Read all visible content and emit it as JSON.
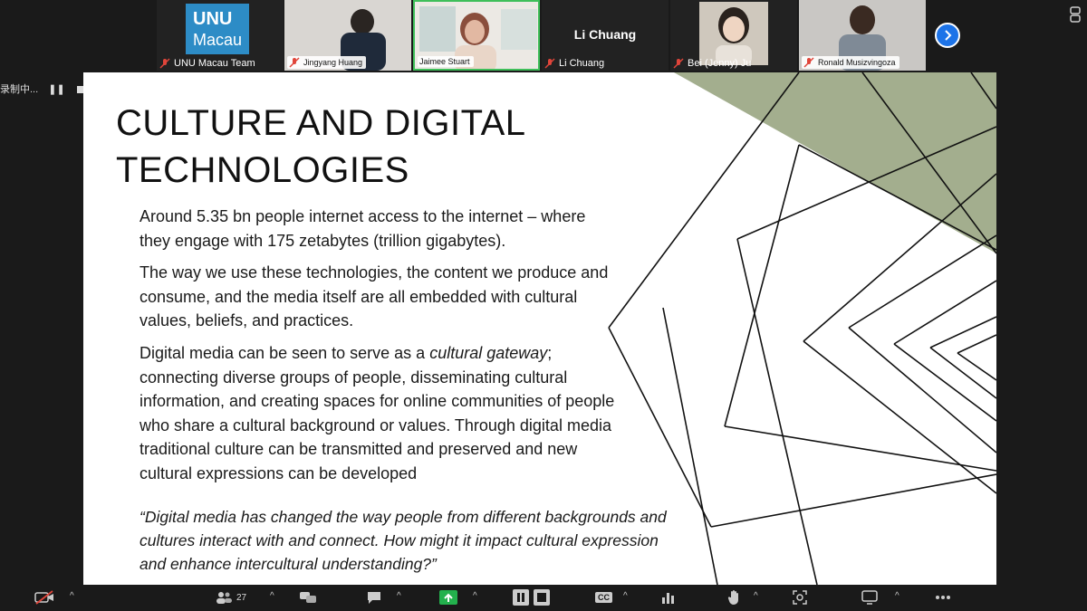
{
  "participants": [
    {
      "name": "UNU Macau Team",
      "muted": true,
      "logo_line1": "UNU",
      "logo_line2": "Macau"
    },
    {
      "name": "Jingyang Huang",
      "muted": true
    },
    {
      "name": "Jaimee Stuart",
      "muted": false
    },
    {
      "name": "Li Chuang",
      "muted": true,
      "display_name": "Li Chuang"
    },
    {
      "name": "Bei (Jenny) Ju",
      "muted": true
    },
    {
      "name": "Ronald Musizvingoza",
      "muted": true
    }
  ],
  "recording": {
    "label": "录制中..."
  },
  "slide": {
    "title": "CULTURE AND DIGITAL TECHNOLOGIES",
    "paragraphs": [
      "Around 5.35 bn people internet access to the internet – where they engage with 175 zetabytes (trillion gigabytes).",
      "The way we use these technologies, the content we produce and consume, and the media itself are all embedded with cultural values, beliefs, and practices."
    ],
    "p3_before": "Digital media can be seen to serve as a ",
    "p3_emphasis": "cultural gateway",
    "p3_after": "; connecting diverse groups of people, disseminating cultural information, and creating spaces for online communities of people who share a cultural background or values. Through digital media traditional culture can be transmitted and preserved and new cultural expressions can be developed",
    "quote": "“Digital media has changed the way people from different backgrounds and cultures interact with and connect. How might it impact cultural expression and enhance intercultural understanding?”",
    "accent_color": "#a3ae8e"
  },
  "toolbar": {
    "participants_count": "27",
    "icons": [
      "video-muted-icon",
      "participants-icon",
      "chat-bubbles-icon",
      "chat-icon",
      "share-screen-icon",
      "pause-share-icon",
      "stop-share-icon",
      "captions-icon",
      "reactions-chart-icon",
      "raise-hand-icon",
      "apps-icon",
      "view-icon",
      "more-icon"
    ],
    "captions_label": "CC"
  }
}
